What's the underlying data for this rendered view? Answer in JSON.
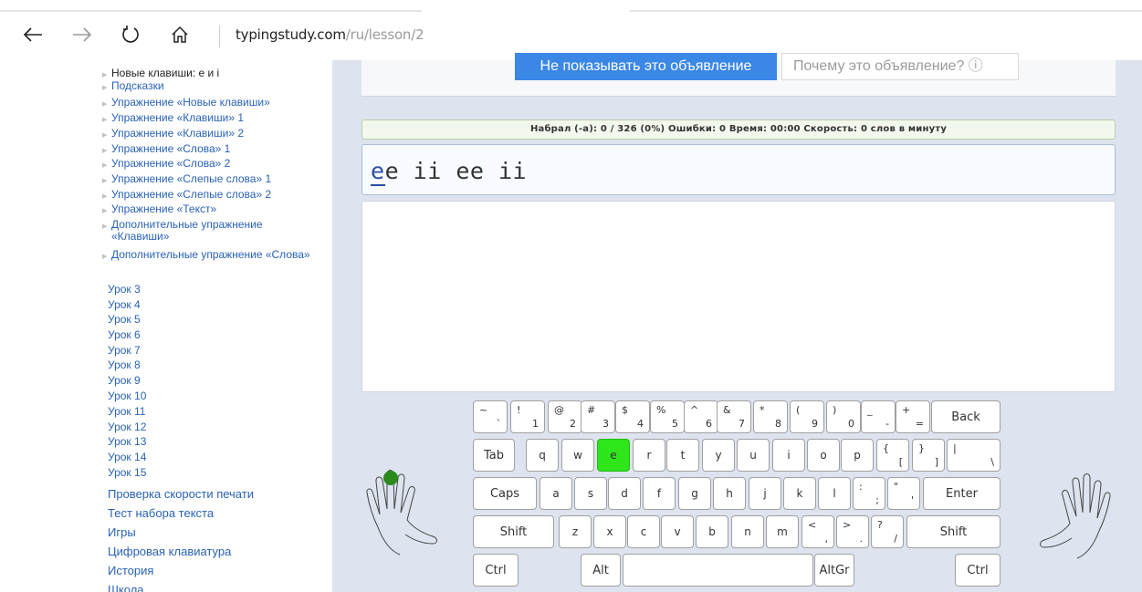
{
  "browser": {
    "domain": "typingstudy.com",
    "path": "/ru/lesson/2",
    "icons": [
      "back-arrow-icon",
      "forward-arrow-icon",
      "refresh-icon",
      "home-icon"
    ]
  },
  "sidebar": {
    "sub_items": [
      "Новые клавиши: е и і",
      "Подсказки",
      "Упражнение «Новые клавиши»",
      "Упражнение «Клавиши» 1",
      "Упражнение «Клавиши» 2",
      "Упражнение «Слова» 1",
      "Упражнение «Слова» 2",
      "Упражнение «Слепые слова» 1",
      "Упражнение «Слепые слова» 2",
      "Упражнение «Текст»",
      "Дополнительные упражнение «Клавиши»",
      "Дополнительные упражнение «Слова»"
    ],
    "lessons": [
      "Урок 3",
      "Урок 4",
      "Урок 5",
      "Урок 6",
      "Урок 7",
      "Урок 8",
      "Урок 9",
      "Урок 10",
      "Урок 11",
      "Урок 12",
      "Урок 13",
      "Урок 14",
      "Урок 15"
    ],
    "menu": [
      "Проверка скорости печати",
      "Тест набора текста",
      "Игры",
      "Цифровая клавиатура",
      "История",
      "Школа"
    ]
  },
  "ad": {
    "hide_label": "Не показывать это объявление",
    "why_label": "Почему это объявление? ⓘ"
  },
  "stats": {
    "text": "Набрал (-а): 0 / 326 (0%) Ошибки: 0 Время: 00:00 Скорость: 0 слов в минуту",
    "typed": 0,
    "total": 326,
    "percent": 0,
    "errors": 0,
    "time": "00:00",
    "speed": 0
  },
  "typing": {
    "current_char": "e",
    "rest": "e ii ee ii"
  },
  "keyboard": {
    "active_key": "e",
    "row1": [
      [
        "~",
        "`"
      ],
      [
        "!",
        "1"
      ],
      [
        "@",
        "2"
      ],
      [
        "#",
        "3"
      ],
      [
        "$",
        "4"
      ],
      [
        "%",
        "5"
      ],
      [
        "^",
        "6"
      ],
      [
        "&",
        "7"
      ],
      [
        "*",
        "8"
      ],
      [
        "(",
        "9"
      ],
      [
        ")",
        "0"
      ],
      [
        "_",
        "-"
      ],
      [
        "+",
        "="
      ]
    ],
    "row1_end": "Back",
    "row2_start": "Tab",
    "row2": [
      "q",
      "w",
      "e",
      "r",
      "t",
      "y",
      "u",
      "i",
      "o",
      "p"
    ],
    "row2_sym": [
      [
        "{",
        "["
      ],
      [
        "}",
        "]"
      ],
      [
        "|",
        "\\"
      ]
    ],
    "row3_start": "Caps",
    "row3": [
      "a",
      "s",
      "d",
      "f",
      "g",
      "h",
      "j",
      "k",
      "l"
    ],
    "row3_sym": [
      [
        ":",
        ";"
      ],
      [
        "\"",
        "'"
      ]
    ],
    "row3_end": "Enter",
    "row4_start": "Shift",
    "row4": [
      "z",
      "x",
      "c",
      "v",
      "b",
      "n",
      "m"
    ],
    "row4_sym": [
      [
        "<",
        ","
      ],
      [
        ">",
        "."
      ],
      [
        "?",
        "/"
      ]
    ],
    "row4_end": "Shift",
    "row5": [
      "Ctrl",
      "Alt",
      "AltGr",
      "Ctrl"
    ]
  },
  "colors": {
    "link": "#2a62b5",
    "panel_bg": "#dde4ef",
    "active_key": "#2ee61a",
    "finger_marker": "#2a8a1e",
    "ad_button": "#3b87e6"
  }
}
